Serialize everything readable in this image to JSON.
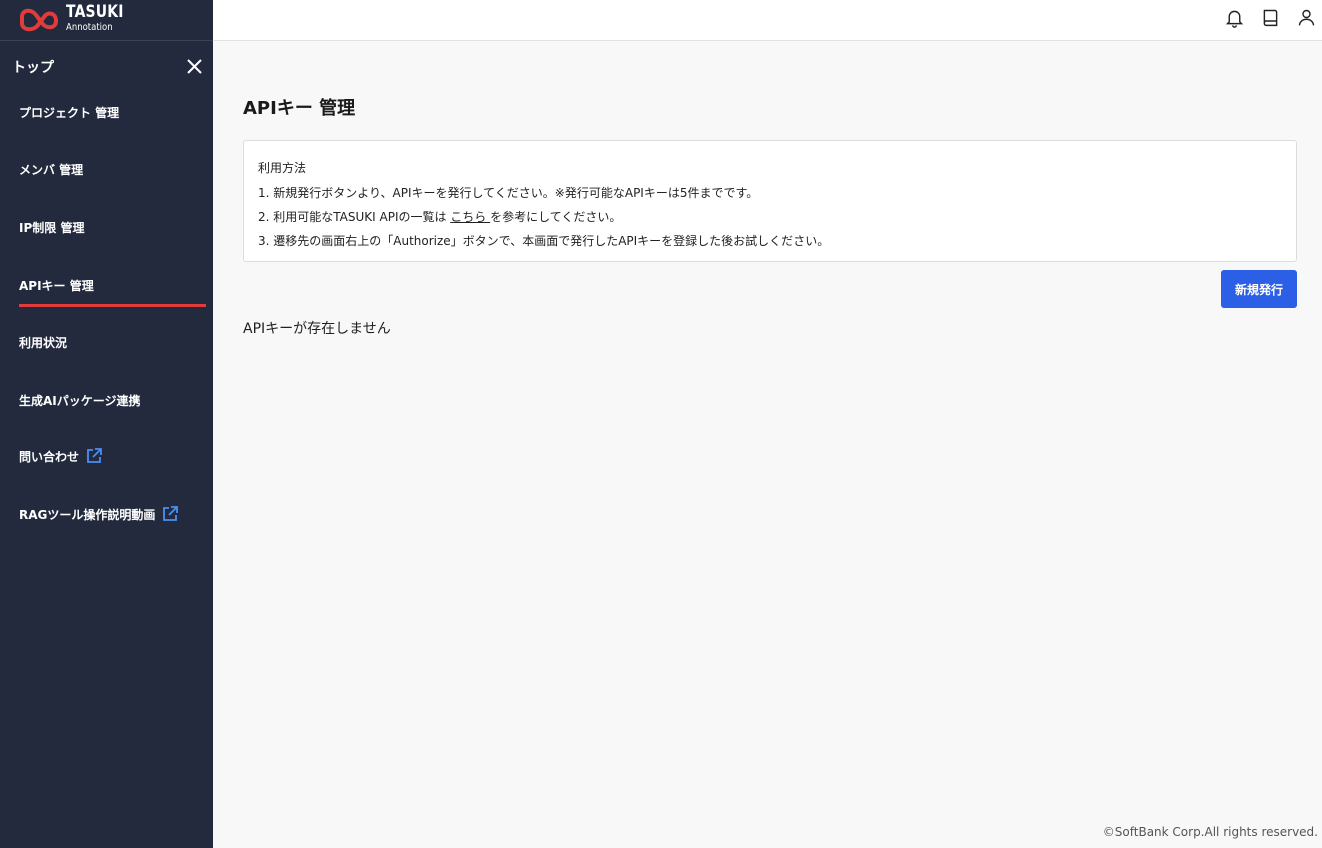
{
  "header": {
    "logo_line1": "TASUKI",
    "logo_line2": "Annotation",
    "icons": [
      "bell-icon",
      "book-icon",
      "user-icon"
    ]
  },
  "sidebar": {
    "top_label": "トップ",
    "items": [
      {
        "label": "プロジェクト 管理"
      },
      {
        "label": "メンバ 管理"
      },
      {
        "label": "IP制限 管理"
      },
      {
        "label": "APIキー 管理",
        "active": true
      },
      {
        "label": "利用状況"
      },
      {
        "label": "生成AIパッケージ連携"
      },
      {
        "label": "問い合わせ",
        "external": true
      },
      {
        "label": "RAGツール操作説明動画",
        "external": true
      }
    ]
  },
  "main": {
    "title": "APIキー 管理",
    "info": {
      "heading": "利用方法",
      "line1": "1. 新規発行ボタンより、APIキーを発行してください。※発行可能なAPIキーは5件までです。",
      "line2_before": "2. 利用可能なTASUKI APIの一覧は ",
      "line2_link": "こちら ",
      "line2_after": "を参考にしてください。",
      "line3": "3. 遷移先の画面右上の「Authorize」ボタンで、本画面で発行したAPIキーを登録した後お試しください。"
    },
    "new_button": "新規発行",
    "empty_message": "APIキーが存在しません"
  },
  "footer": "©SoftBank Corp.All rights reserved.",
  "colors": {
    "sidebar_bg": "#232a3d",
    "accent_red": "#e23b3b",
    "button_blue": "#2a5fe6",
    "link_icon_blue": "#4a8ff5"
  }
}
